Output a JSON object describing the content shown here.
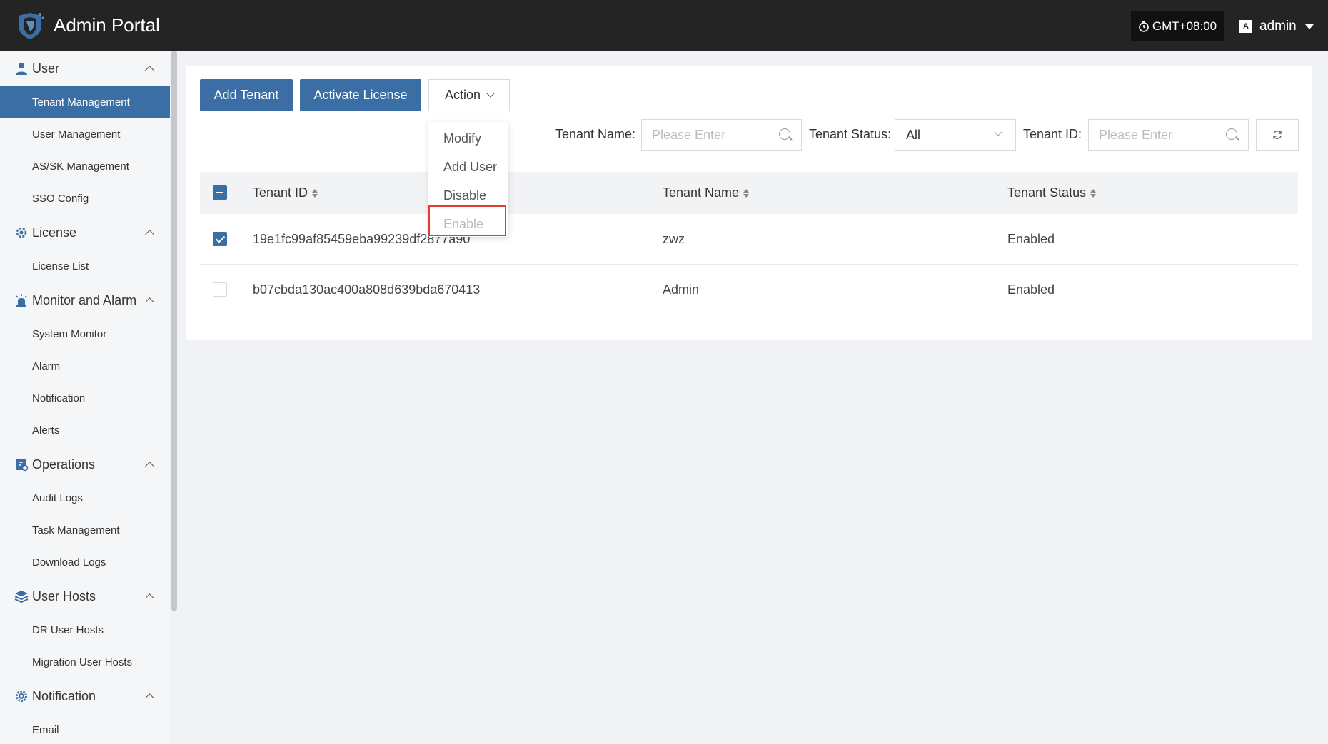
{
  "header": {
    "title": "Admin Portal",
    "timezone": "GMT+08:00",
    "username": "admin"
  },
  "sidebar": {
    "groups": [
      {
        "label": "User",
        "icon": "user-icon",
        "items": [
          "Tenant Management",
          "User Management",
          "AS/SK Management",
          "SSO Config"
        ]
      },
      {
        "label": "License",
        "icon": "license-icon",
        "items": [
          "License List"
        ]
      },
      {
        "label": "Monitor and Alarm",
        "icon": "alarm-icon",
        "items": [
          "System Monitor",
          "Alarm",
          "Notification",
          "Alerts"
        ]
      },
      {
        "label": "Operations",
        "icon": "operations-icon",
        "items": [
          "Audit Logs",
          "Task Management",
          "Download Logs"
        ]
      },
      {
        "label": "User Hosts",
        "icon": "layers-icon",
        "items": [
          "DR User Hosts",
          "Migration User Hosts"
        ]
      },
      {
        "label": "Notification",
        "icon": "gear-icon",
        "items": [
          "Email"
        ]
      }
    ],
    "active_item": "Tenant Management"
  },
  "toolbar": {
    "add_tenant": "Add Tenant",
    "activate_license": "Activate License",
    "action": "Action"
  },
  "action_menu": {
    "items": [
      "Modify",
      "Add User",
      "Disable",
      "Enable"
    ],
    "disabled": [
      "Enable"
    ]
  },
  "filters": {
    "tenant_name_label": "Tenant Name:",
    "tenant_name_placeholder": "Please Enter",
    "tenant_status_label": "Tenant Status:",
    "tenant_status_value": "All",
    "tenant_id_label": "Tenant ID:",
    "tenant_id_placeholder": "Please Enter"
  },
  "table": {
    "columns": [
      "Tenant ID",
      "Tenant Name",
      "Tenant Status"
    ],
    "rows": [
      {
        "id": "19e1fc99af85459eba99239df2877a90",
        "name": "zwz",
        "status": "Enabled",
        "checked": true
      },
      {
        "id": "b07cbda130ac400a808d639bda670413",
        "name": "Admin",
        "status": "Enabled",
        "checked": false
      }
    ]
  },
  "colors": {
    "primary": "#3a6ea5",
    "header_bg": "#242424",
    "highlight_border": "#e53935"
  }
}
